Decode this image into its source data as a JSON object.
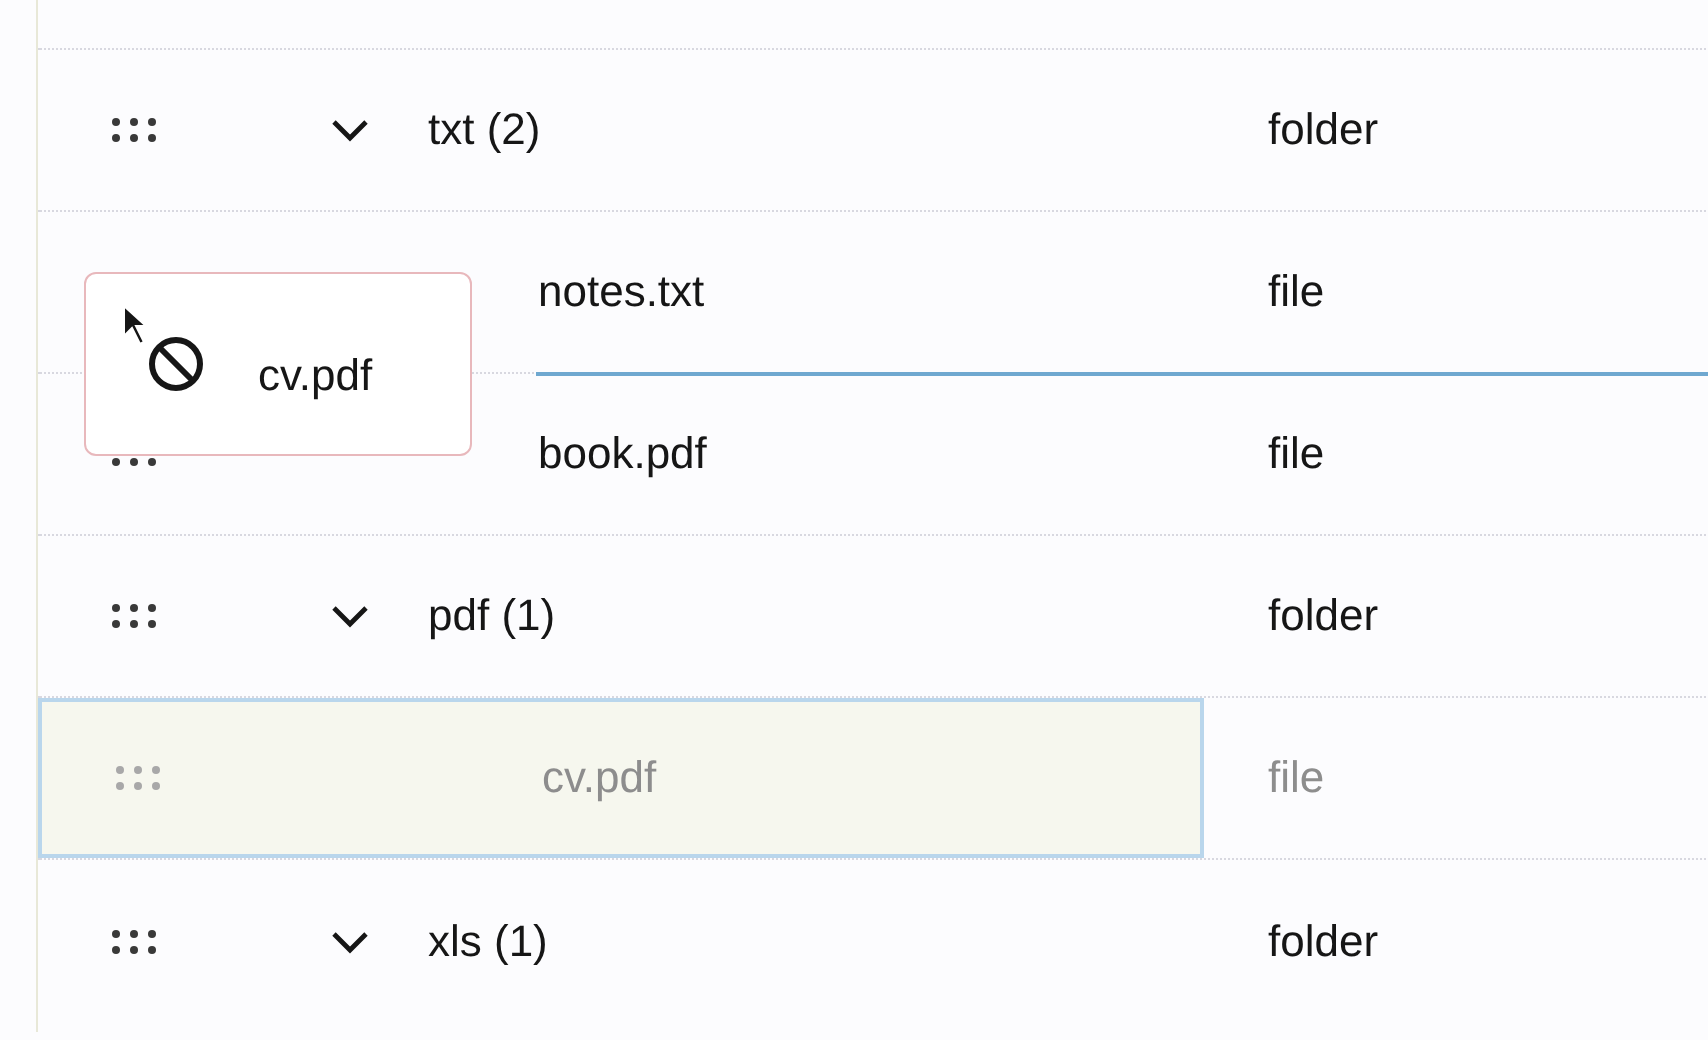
{
  "rows": [
    {
      "kind": "group",
      "name": "txt (2)",
      "type": "folder",
      "expanded": true,
      "children": [
        {
          "kind": "item",
          "name": "notes.txt",
          "type": "file",
          "dragging": false,
          "drop_below": true
        },
        {
          "kind": "item",
          "name": "book.pdf",
          "type": "file",
          "dragging": false,
          "drop_below": false
        }
      ]
    },
    {
      "kind": "group",
      "name": "pdf (1)",
      "type": "folder",
      "expanded": true,
      "children": [
        {
          "kind": "item",
          "name": "cv.pdf",
          "type": "file",
          "dragging": true,
          "drop_below": false
        }
      ]
    },
    {
      "kind": "group",
      "name": "xls (1)",
      "type": "folder",
      "expanded": true,
      "children": []
    }
  ],
  "drag_preview": {
    "label": "cv.pdf",
    "allowed": false
  }
}
